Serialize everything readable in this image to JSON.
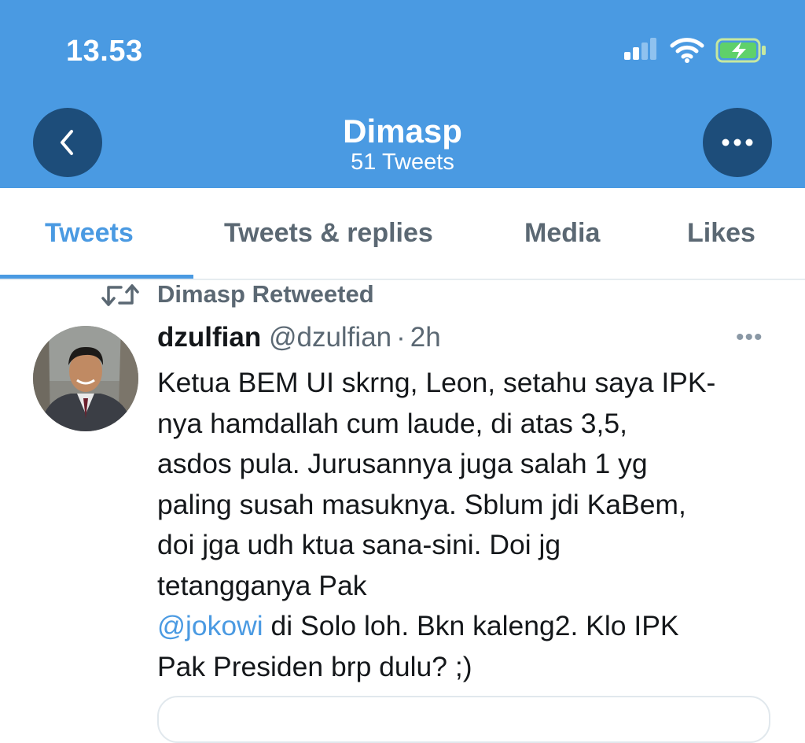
{
  "status_bar": {
    "time": "13.53",
    "icons": [
      "cellular-signal-icon",
      "wifi-icon",
      "battery-charging-icon"
    ]
  },
  "header": {
    "back_icon": "chevron-left-icon",
    "title": "Dimasp",
    "subtitle": "51 Tweets",
    "more_icon": "more-horizontal-icon"
  },
  "tabs": [
    {
      "label": "Tweets",
      "active": true
    },
    {
      "label": "Tweets & replies",
      "active": false
    },
    {
      "label": "Media",
      "active": false
    },
    {
      "label": "Likes",
      "active": false
    }
  ],
  "tweet": {
    "retweet_label": "Dimasp Retweeted",
    "author_name": "dzulfian",
    "author_handle": "@dzulfian",
    "separator": "·",
    "time": "2h",
    "more_label": "•••",
    "body_before_mention": "Ketua BEM UI skrng, Leon, setahu saya IPK-\nnya hamdallah cum laude, di atas 3,5,\nasdos pula. Jurusannya juga salah 1 yg\npaling susah masuknya.  Sblum jdi KaBem,\ndoi jga udh ktua sana-sini. Doi jg\ntetangganya Pak\n",
    "mention": "@jokowi",
    "body_after_mention": " di Solo loh. Bkn kaleng2. Klo IPK\nPak Presiden brp dulu? ;)"
  },
  "colors": {
    "header_bg": "#4a9ae2",
    "button_bg": "#1d4d7a",
    "accent": "#4a9ae2",
    "secondary_text": "#5b6873"
  }
}
